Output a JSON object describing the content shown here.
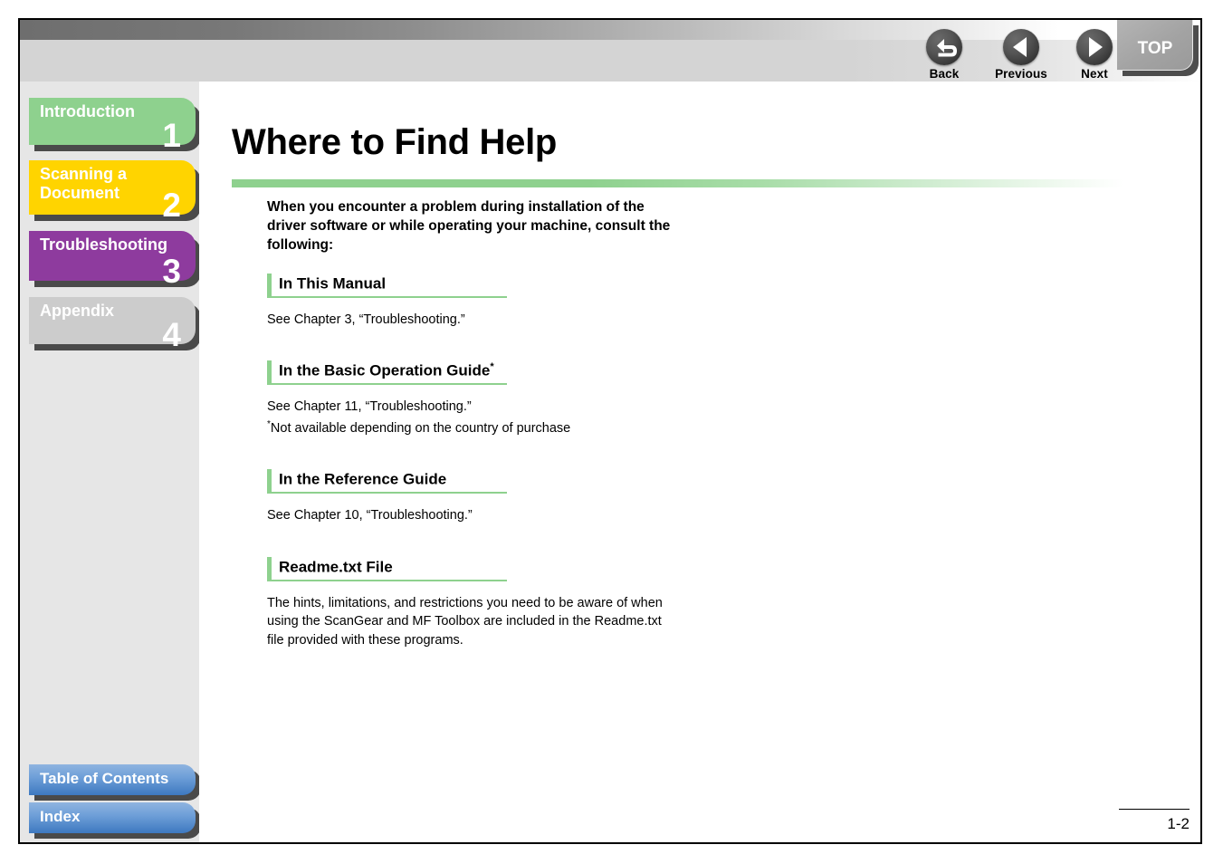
{
  "header": {
    "nav_buttons": [
      {
        "label": "Back",
        "icon": "back-arrow-icon"
      },
      {
        "label": "Previous",
        "icon": "left-triangle-icon"
      },
      {
        "label": "Next",
        "icon": "right-triangle-icon"
      }
    ],
    "top_button_label": "TOP"
  },
  "sidebar": {
    "chapters": [
      {
        "label": "Introduction",
        "number": "1",
        "color": "#8ed18e"
      },
      {
        "label": "Scanning a\nDocument",
        "number": "2",
        "color": "#ffd400"
      },
      {
        "label": "Troubleshooting",
        "number": "3",
        "color": "#8e3b9e"
      },
      {
        "label": "Appendix",
        "number": "4",
        "color": "#cccccc"
      }
    ],
    "bottom_items": [
      {
        "label": "Table of Contents"
      },
      {
        "label": "Index"
      }
    ]
  },
  "main": {
    "title": "Where to Find Help",
    "intro": "When you encounter a problem during installation of the driver software or while operating your machine, consult the following:",
    "sections": [
      {
        "heading": "In This Manual",
        "heading_sup": "",
        "body": "See Chapter 3, “Troubleshooting.”",
        "note_sup": "",
        "note": ""
      },
      {
        "heading": "In the Basic Operation Guide",
        "heading_sup": "*",
        "body": "See Chapter 11, “Troubleshooting.”",
        "note_sup": "*",
        "note": "Not available depending on the country of purchase"
      },
      {
        "heading": "In the Reference Guide",
        "heading_sup": "",
        "body": "See Chapter 10, “Troubleshooting.”",
        "note_sup": "",
        "note": ""
      },
      {
        "heading": "Readme.txt File",
        "heading_sup": "",
        "body": "The hints, limitations, and restrictions you need to be aware of when using the ScanGear and MF Toolbox are included in the Readme.txt file provided with these programs.",
        "note_sup": "",
        "note": ""
      }
    ]
  },
  "footer": {
    "page_number": "1-2"
  }
}
